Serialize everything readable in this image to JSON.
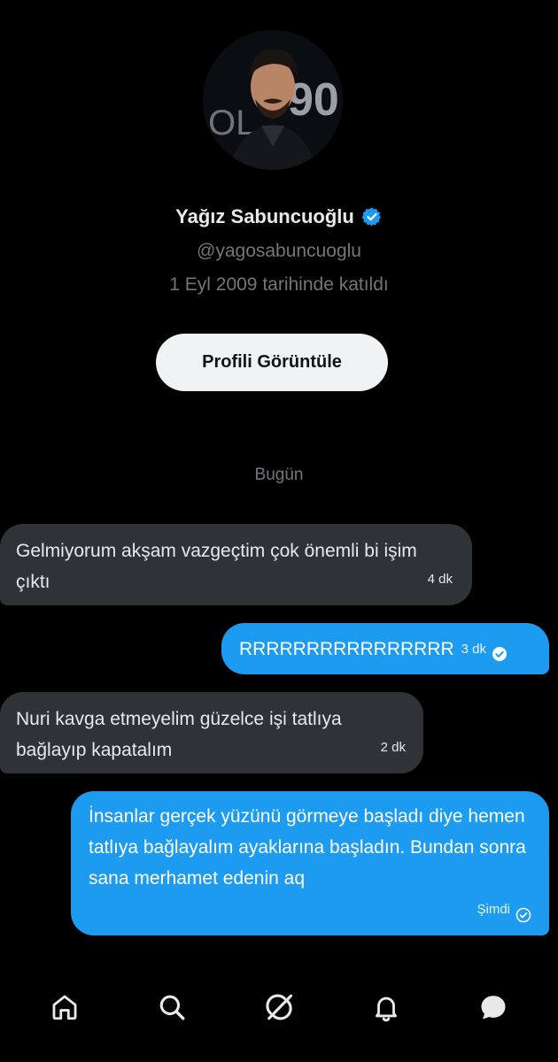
{
  "profile": {
    "name": "Yağız Sabuncuoğlu",
    "handle": "@yagosabuncuoglu",
    "joined": "1 Eyl 2009 tarihinde katıldı",
    "view_profile_label": "Profili Görüntüle",
    "verified_icon": "verified-badge-icon",
    "verified_color": "#1d9bf0"
  },
  "conversation": {
    "date_separator": "Bugün",
    "messages": [
      {
        "direction": "incoming",
        "text": "Gelmiyorum akşam vazgeçtim çok önemli bi işim çıktı",
        "time": "4 dk"
      },
      {
        "direction": "outgoing",
        "text": "RRRRRRRRRRRRRRRR",
        "time": "3 dk",
        "status_icon": "read-check-icon"
      },
      {
        "direction": "incoming",
        "text": "Nuri kavga etmeyelim güzelce işi tatlıya bağlayıp kapatalım",
        "time": "2 dk"
      },
      {
        "direction": "outgoing",
        "text": "İnsanlar gerçek yüzünü görmeye başladı diye hemen tatlıya bağlayalım ayaklarına başladın. Bundan sonra sana merhamet edenin aq",
        "time": "Şimdi",
        "status_icon": "sent-check-icon"
      }
    ]
  },
  "colors": {
    "background": "#000000",
    "incoming_bubble": "#2f3336",
    "outgoing_bubble": "#1d9bf0",
    "secondary_text": "#71767b"
  },
  "nav": {
    "items": [
      "home-icon",
      "search-icon",
      "grok-icon",
      "notifications-icon",
      "messages-icon"
    ]
  }
}
